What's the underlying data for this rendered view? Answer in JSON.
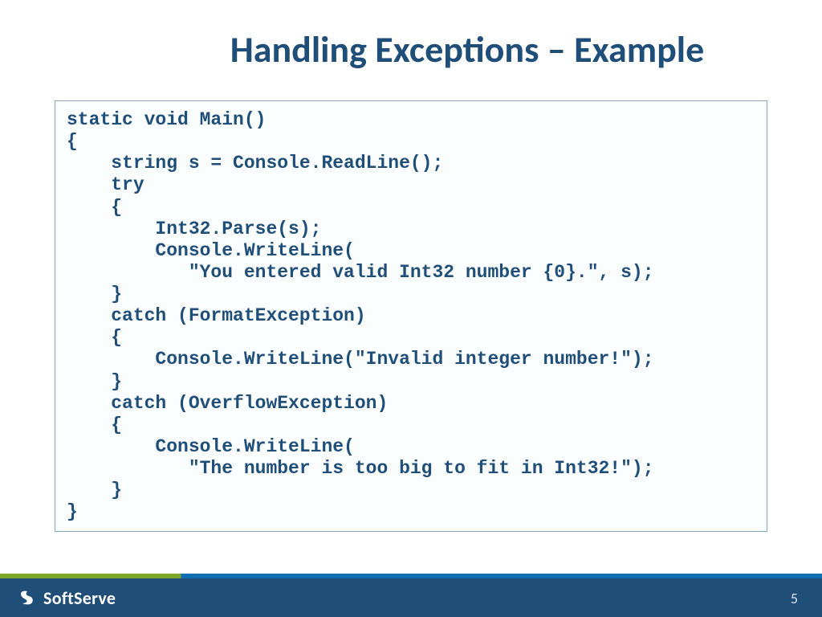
{
  "slide": {
    "title": "Handling Exceptions – Example",
    "code": "static void Main()\n{\n    string s = Console.ReadLine();\n    try\n    {\n        Int32.Parse(s);\n        Console.WriteLine(\n           \"You entered valid Int32 number {0}.\", s);\n    }\n    catch (FormatException)\n    {\n        Console.WriteLine(\"Invalid integer number!\");\n    }\n    catch (OverflowException)\n    {\n        Console.WriteLine(\n           \"The number is too big to fit in Int32!\");\n    }\n}"
  },
  "footer": {
    "brand": "SoftServe",
    "page_number": "5"
  }
}
